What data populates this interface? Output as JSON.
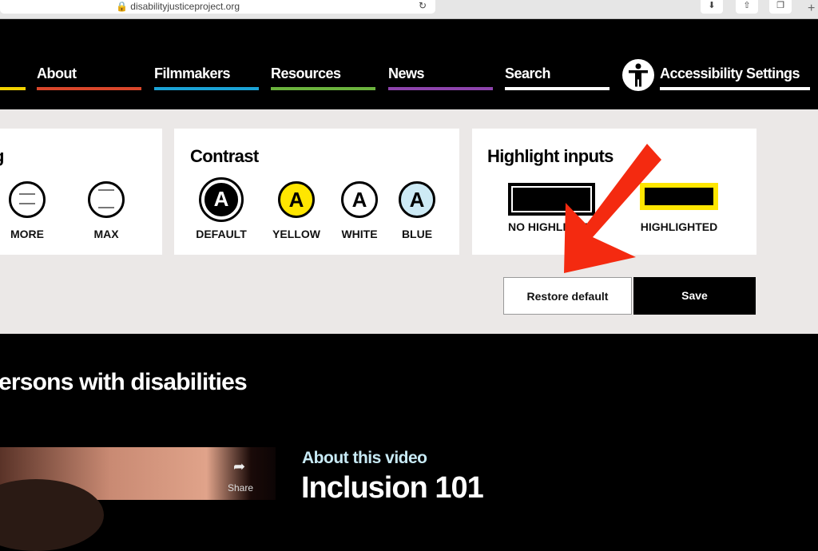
{
  "browser": {
    "url": "disabilityjusticeproject.org"
  },
  "nav": {
    "items": [
      {
        "label": "About",
        "color": "#d9472b"
      },
      {
        "label": "Filmmakers",
        "color": "#1ba3d6"
      },
      {
        "label": "Resources",
        "color": "#6bb33d"
      },
      {
        "label": "News",
        "color": "#8e44ad"
      },
      {
        "label": "Search",
        "color": "#ffffff"
      }
    ],
    "first_color": "#f2d200",
    "accessibility": "Accessibility Settings"
  },
  "spacing": {
    "title_partial": "g",
    "options": [
      "MORE",
      "MAX"
    ]
  },
  "contrast": {
    "title": "Contrast",
    "options": [
      {
        "label": "DEFAULT",
        "glyph": "A",
        "bg": "#000000",
        "fg": "#ffffff"
      },
      {
        "label": "YELLOW",
        "glyph": "A",
        "bg": "#ffe600",
        "fg": "#000000"
      },
      {
        "label": "WHITE",
        "glyph": "A",
        "bg": "#ffffff",
        "fg": "#000000"
      },
      {
        "label": "BLUE",
        "glyph": "A",
        "bg": "#cdeaf5",
        "fg": "#000000"
      }
    ]
  },
  "highlight": {
    "title": "Highlight inputs",
    "options": [
      "NO HIGHLIGHT",
      "HIGHLIGHTED"
    ]
  },
  "buttons": {
    "restore": "Restore default",
    "save": "Save"
  },
  "section": {
    "heading": "ersons with disabilities"
  },
  "video": {
    "share": "Share",
    "about": "About this video",
    "title": "Inclusion 101"
  },
  "annotation": {
    "arrow_color": "#f42a10"
  }
}
